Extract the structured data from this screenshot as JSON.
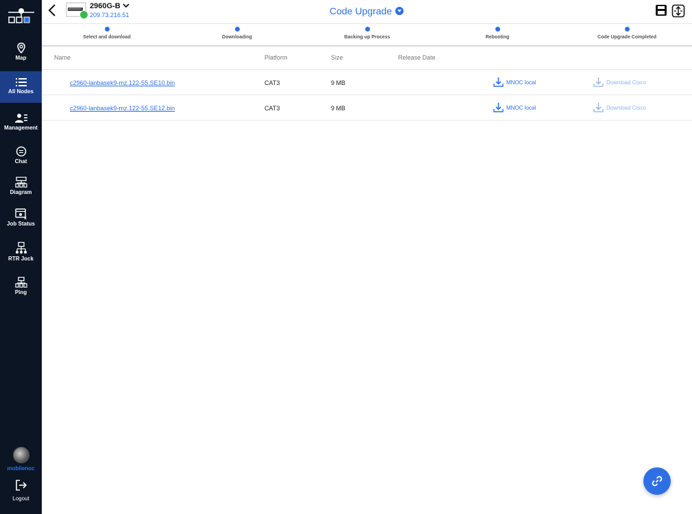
{
  "sidebar": {
    "items": [
      {
        "label": "Map",
        "icon": "map-pin-icon"
      },
      {
        "label": "All Nodes",
        "icon": "list-icon"
      },
      {
        "label": "Management",
        "icon": "user-management-icon"
      },
      {
        "label": "Chat",
        "icon": "chat-icon"
      },
      {
        "label": "Diagram",
        "icon": "diagram-icon"
      },
      {
        "label": "Job Status",
        "icon": "job-status-icon"
      },
      {
        "label": "RTR Jock",
        "icon": "network-tree-icon"
      },
      {
        "label": "Ping",
        "icon": "ping-icon"
      }
    ],
    "user_label": "mobilenoc",
    "logout_label": "Logout"
  },
  "header": {
    "device_name": "2960G-B",
    "device_ip": "209.73.216.51",
    "title": "Code Upgrade"
  },
  "steps": [
    "Select and download",
    "Downloading",
    "Backing up Process",
    "Rebooting",
    "Code Upgrade Completed"
  ],
  "table": {
    "columns": [
      "Name",
      "Platform",
      "Size",
      "Release Date"
    ],
    "rows": [
      {
        "name": "c2960-lanbasek9-mz.122-55.SE10.bin",
        "platform": "CAT3",
        "size": "9 MB",
        "release_date": "",
        "local": "MNOC local",
        "cisco": "Download Cisco"
      },
      {
        "name": "c2960-lanbasek9-mz.122-55.SE12.bin",
        "platform": "CAT3",
        "size": "9 MB",
        "release_date": "",
        "local": "MNOC local",
        "cisco": "Download Cisco"
      }
    ]
  },
  "colors": {
    "accent": "#2f6fe4",
    "sidebar_bg": "#0b1524",
    "sidebar_active": "#1d3f8a",
    "status_online": "#3aba4d"
  }
}
